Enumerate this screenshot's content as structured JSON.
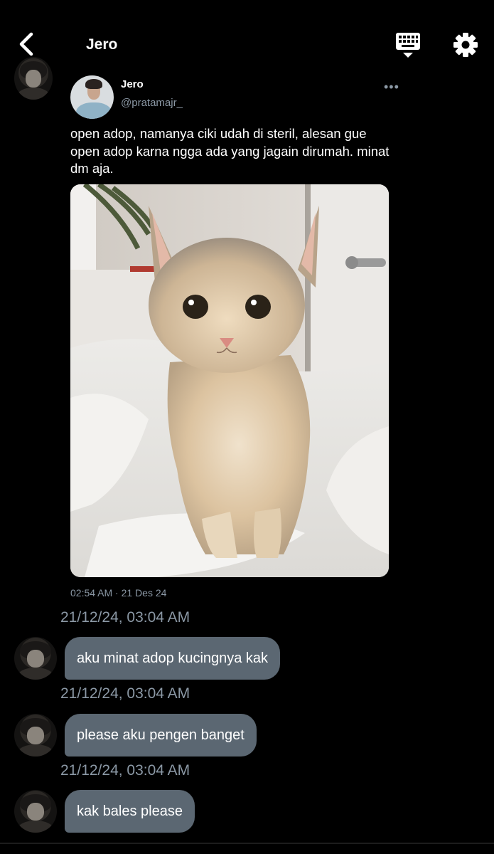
{
  "header": {
    "title": "Jero",
    "back_icon": "chevron-left-icon",
    "keyboard_icon": "keyboard-icon",
    "settings_icon": "gear-icon"
  },
  "tweet": {
    "name": "Jero",
    "handle": "@pratamajr_",
    "more": "•••",
    "text": "open adop, namanya ciki udah di steril, alesan gue open adop karna ngga ada yang jagain dirumah. minat dm aja.",
    "timestamp": "02:54 AM · 21 Des 24"
  },
  "messages": [
    {
      "timestamp": "21/12/24, 03:04 AM",
      "text": "aku minat adop kucingnya kak"
    },
    {
      "timestamp": "21/12/24, 03:04 AM",
      "text": "please aku pengen banget"
    },
    {
      "timestamp": "21/12/24, 03:04 AM",
      "text": "kak bales please"
    }
  ],
  "colors": {
    "background": "#000000",
    "bubble": "#5b6772",
    "muted_text": "#8b98a5"
  }
}
